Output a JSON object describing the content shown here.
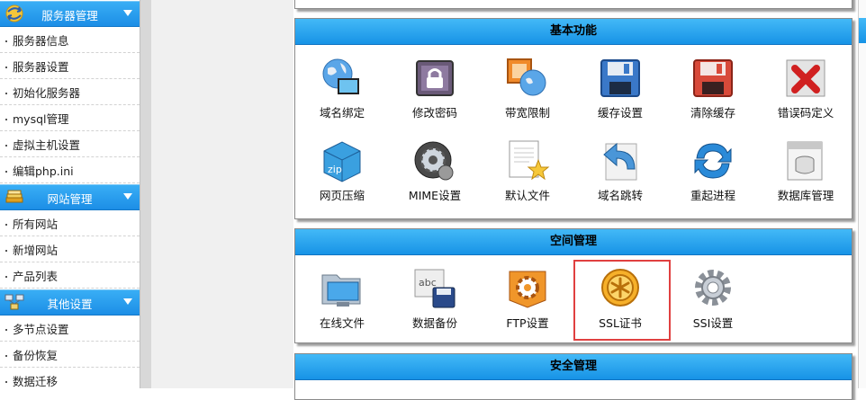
{
  "sidebar": {
    "sections": [
      {
        "title": "服务器管理",
        "icon": "arrows-swap-icon",
        "items": [
          "服务器信息",
          "服务器设置",
          "初始化服务器",
          "mysql管理",
          "虚拟主机设置",
          "编辑php.ini"
        ]
      },
      {
        "title": "网站管理",
        "icon": "stack-books-icon",
        "items": [
          "所有网站",
          "新增网站",
          "产品列表"
        ]
      },
      {
        "title": "其他设置",
        "icon": "network-icon",
        "items": [
          "多节点设置",
          "备份恢复",
          "数据迁移"
        ]
      }
    ]
  },
  "panels": {
    "basic": {
      "title": "基本功能",
      "tiles": [
        {
          "label": "域名绑定",
          "icon": "globe-window-icon"
        },
        {
          "label": "修改密码",
          "icon": "padlock-icon"
        },
        {
          "label": "带宽限制",
          "icon": "bandwidth-globe-icon"
        },
        {
          "label": "缓存设置",
          "icon": "floppy-disk-icon"
        },
        {
          "label": "清除缓存",
          "icon": "floppy-disk-red-icon"
        },
        {
          "label": "错误码定义",
          "icon": "red-x-icon"
        },
        {
          "label": "网页压缩",
          "icon": "zip-box-icon"
        },
        {
          "label": "MIME设置",
          "icon": "gear-wheel-icon"
        },
        {
          "label": "默认文件",
          "icon": "document-star-icon"
        },
        {
          "label": "域名跳转",
          "icon": "redirect-arrow-icon"
        },
        {
          "label": "重起进程",
          "icon": "refresh-arrows-icon"
        },
        {
          "label": "数据库管理",
          "icon": "database-icon"
        }
      ]
    },
    "space": {
      "title": "空间管理",
      "tiles": [
        {
          "label": "在线文件",
          "icon": "folder-monitor-icon"
        },
        {
          "label": "数据备份",
          "icon": "abc-floppy-icon"
        },
        {
          "label": "FTP设置",
          "icon": "ftp-gear-icon"
        },
        {
          "label": "SSL证书",
          "icon": "ssl-badge-icon"
        },
        {
          "label": "SSI设置",
          "icon": "silver-gear-icon"
        }
      ]
    },
    "security": {
      "title": "安全管理"
    }
  }
}
